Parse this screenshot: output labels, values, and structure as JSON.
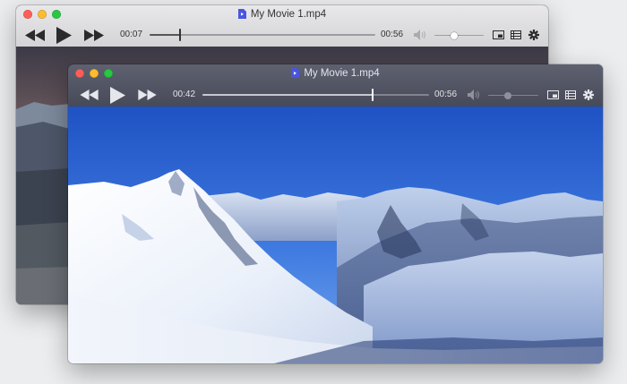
{
  "back_window": {
    "title": "My Movie 1.mp4",
    "elapsed": "00:07",
    "duration": "00:56",
    "progress": 0.135,
    "volume": 0.4
  },
  "front_window": {
    "title": "My Movie 1.mp4",
    "elapsed": "00:42",
    "duration": "00:56",
    "progress": 0.75,
    "volume": 0.4
  },
  "icons": [
    "rewind-icon",
    "play-icon",
    "fast-forward-icon",
    "speaker-icon",
    "picture-in-picture-icon",
    "playlist-icon",
    "gear-icon",
    "file-icon"
  ],
  "colors": {
    "close": "#fd5f57",
    "minimize": "#febc2e",
    "zoom": "#28c840",
    "file_icon": "#4a55e0"
  }
}
